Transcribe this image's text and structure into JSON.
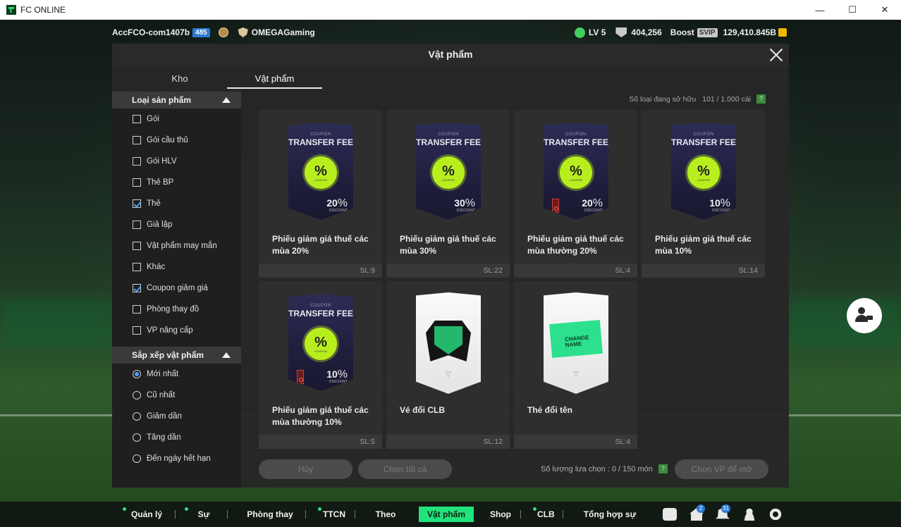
{
  "window": {
    "title": "FC ONLINE",
    "controls": [
      "—",
      "☐",
      "✕"
    ]
  },
  "topbar": {
    "account": "AccFCO-com1407b",
    "account_badge": "485",
    "club": "OMEGAGaming",
    "level": "LV 5",
    "ovr": "404,256",
    "boost": "Boost",
    "svip": "SVIP",
    "bp": "129,410.845B"
  },
  "modal": {
    "title": "Vật phẩm",
    "tabs": [
      "Kho",
      "Vật phẩm"
    ],
    "owned_label": "Số loại đang sở hữu   101 / 1.000 cái",
    "help": "?",
    "sidebar": {
      "filter_header": "Loại sản phẩm",
      "filters": [
        {
          "label": "Gói",
          "checked": false
        },
        {
          "label": "Gói cầu thủ",
          "checked": false
        },
        {
          "label": "Gói HLV",
          "checked": false
        },
        {
          "label": "Thẻ BP",
          "checked": false
        },
        {
          "label": "Thẻ",
          "checked": true
        },
        {
          "label": "Giả lập",
          "checked": false
        },
        {
          "label": "Vật phẩm may mắn",
          "checked": false
        },
        {
          "label": "Khác",
          "checked": false
        },
        {
          "label": "Coupon giảm giá",
          "checked": true
        },
        {
          "label": "Phòng thay đồ",
          "checked": false
        },
        {
          "label": "VP nâng cấp",
          "checked": false
        }
      ],
      "sort_header": "Sắp xếp vật phẩm",
      "sorts": [
        {
          "label": "Mới nhất",
          "selected": true
        },
        {
          "label": "Cũ nhất",
          "selected": false
        },
        {
          "label": "Giảm dần",
          "selected": false
        },
        {
          "label": "Tăng dần",
          "selected": false
        },
        {
          "label": "Đến ngày hết hạn",
          "selected": false
        }
      ]
    },
    "items": [
      {
        "type": "coupon",
        "small": "COUPON",
        "title": "TRANSFER FEE",
        "badge": "%",
        "badge_label": "COUPON",
        "discount": "20",
        "discount_sub": "DISCOUNT",
        "lock": false,
        "name": "Phiếu giảm giá thuế các mùa 20%",
        "qty": "SL:9"
      },
      {
        "type": "coupon",
        "small": "COUPON",
        "title": "TRANSFER FEE",
        "badge": "%",
        "badge_label": "COUPON",
        "discount": "30",
        "discount_sub": "DISCOUNT",
        "lock": false,
        "name": "Phiếu giảm giá thuế các mùa 30%",
        "qty": "SL:22"
      },
      {
        "type": "coupon",
        "small": "COUPON",
        "title": "TRANSFER FEE",
        "badge": "%",
        "badge_label": "COUPON",
        "discount": "20",
        "discount_sub": "DISCOUNT",
        "lock": true,
        "name": "Phiếu giảm giá thuế các mùa thường 20%",
        "qty": "SL:4"
      },
      {
        "type": "coupon",
        "small": "COUPON",
        "title": "TRANSFER FEE",
        "badge": "%",
        "badge_label": "COUPON",
        "discount": "10",
        "discount_sub": "DISCOUNT",
        "lock": false,
        "name": "Phiếu giảm giá thuế các mùa 10%",
        "qty": "SL:14"
      },
      {
        "type": "coupon",
        "small": "COUPON",
        "title": "TRANSFER FEE",
        "badge": "%",
        "badge_label": "COUPON",
        "discount": "10",
        "discount_sub": "DISCOUNT",
        "lock": true,
        "name": "Phiếu giảm giá thuế các mùa thường 10%",
        "qty": "SL:5"
      },
      {
        "type": "club-ticket",
        "name": "Vé đổi CLB",
        "qty": "SL:12"
      },
      {
        "type": "name-card",
        "card_text": "CHANGE NAME",
        "name": "Thẻ đổi tên",
        "qty": "SL:4"
      }
    ],
    "buttons": {
      "cancel": "Hủy",
      "select_all": "Chọn tất cả",
      "open": "Chọn VP để mở"
    },
    "selection_count": "Số lượng lựa chọn : 0 / 150 món"
  },
  "bottom_nav": {
    "items": [
      {
        "label": "Quản lý CT",
        "dot": true
      },
      {
        "label": "Sự kiện",
        "dot": true
      },
      {
        "label": "Phòng thay đổ",
        "dot": false
      },
      {
        "label": "TTCN",
        "dot": true
      },
      {
        "label": "Theo dõi",
        "dot": false
      },
      {
        "label": "Vật phẩm",
        "dot": false,
        "active": true
      },
      {
        "label": "Shop",
        "dot": false
      },
      {
        "label": "CLB",
        "dot": true
      },
      {
        "label": "Tổng hợp sự kiện",
        "dot": false
      }
    ],
    "icons": [
      "chat-icon",
      "home-icon",
      "bell-icon",
      "profile-icon",
      "gear-icon"
    ],
    "home_badge": "2",
    "bell_badge": "31"
  },
  "colors": {
    "accent": "#21e37b",
    "coupon_badge": "#b9ee1e",
    "check": "#4aa3ff"
  }
}
